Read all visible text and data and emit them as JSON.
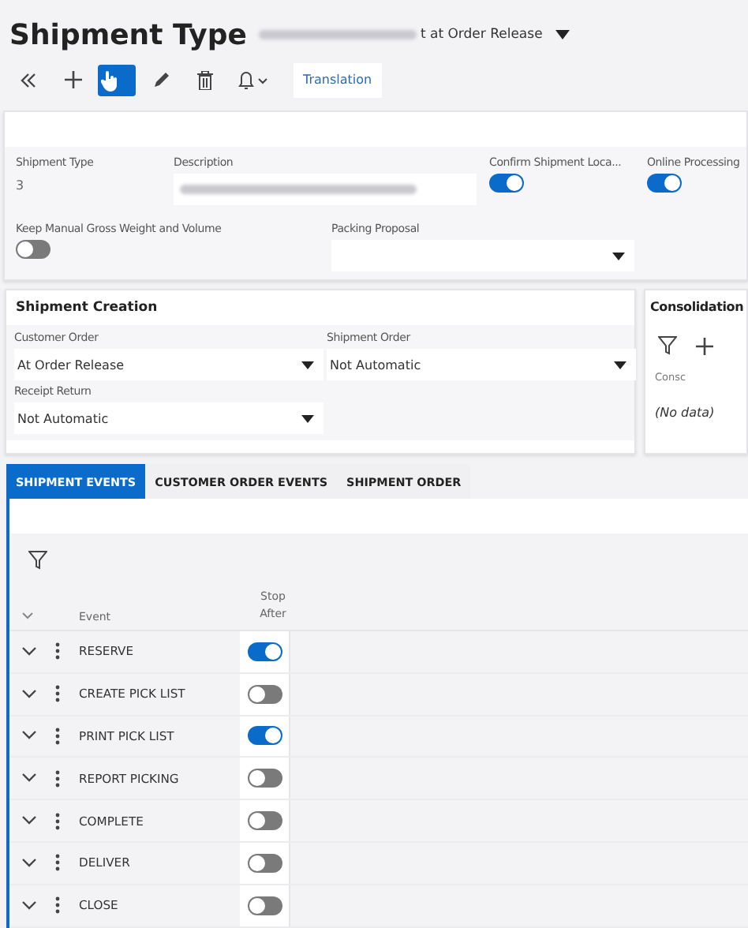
{
  "page": {
    "title": "Shipment Type",
    "subtitle": "t at Order Release"
  },
  "toolbar": {
    "buttons": [
      {
        "kind": "collapse",
        "selected": false
      },
      {
        "kind": "add",
        "selected": false
      },
      {
        "kind": "hand",
        "selected": true
      },
      {
        "kind": "edit",
        "selected": false
      },
      {
        "kind": "delete",
        "selected": false
      },
      {
        "kind": "bell",
        "selected": false
      }
    ],
    "translation": "Translation"
  },
  "header": {
    "shipment_type": {
      "label": "Shipment Type",
      "value": "3"
    },
    "description": {
      "label": "Description"
    },
    "confirm": {
      "label": "Confirm Shipment Loca...",
      "on": true
    },
    "online": {
      "label": "Online Processing",
      "on": true
    },
    "keep_manual": {
      "label": "Keep Manual Gross Weight and Volume",
      "on": false
    },
    "packing": {
      "label": "Packing Proposal"
    }
  },
  "shipment_creation": {
    "title": "Shipment Creation",
    "fields": [
      {
        "label": "Customer Order",
        "value": "At Order Release"
      },
      {
        "label": "Shipment Order",
        "value": "Not Automatic"
      },
      {
        "label": "Receipt Return",
        "value": "Not Automatic"
      }
    ]
  },
  "consolidation": {
    "title": "Consolidation",
    "column_1": "Consc",
    "empty": "(No data)"
  },
  "tabs": [
    {
      "label": "SHIPMENT EVENTS",
      "selected": true
    },
    {
      "label": "CUSTOMER ORDER EVENTS",
      "selected": false
    },
    {
      "label": "SHIPMENT ORDER",
      "selected": false
    }
  ],
  "table": {
    "columns": [
      "Event",
      "Stop After"
    ],
    "rows": [
      {
        "event": "RESERVE",
        "stop_after": true
      },
      {
        "event": "CREATE PICK LIST",
        "stop_after": false
      },
      {
        "event": "PRINT PICK LIST",
        "stop_after": true
      },
      {
        "event": "REPORT PICKING",
        "stop_after": false
      },
      {
        "event": "COMPLETE",
        "stop_after": false
      },
      {
        "event": "DELIVER",
        "stop_after": false
      },
      {
        "event": "CLOSE",
        "stop_after": false
      }
    ]
  }
}
